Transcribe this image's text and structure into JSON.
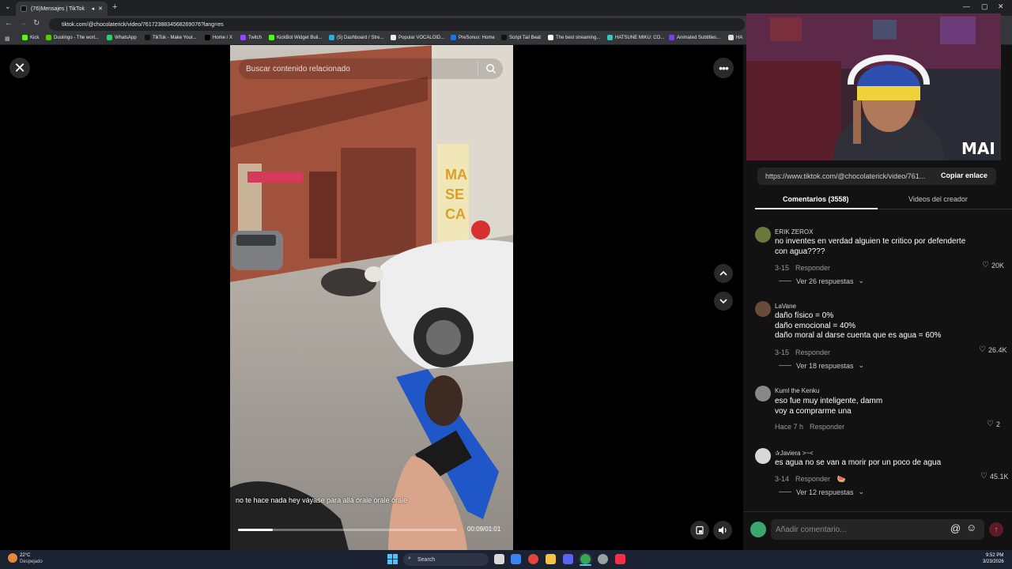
{
  "browser": {
    "tabs": [
      {
        "label": "(76)Mensajes | TikTok",
        "active": true
      },
      {
        "label": "",
        "active": false
      }
    ],
    "url": "tiktok.com/@chocolaterick/video/7617238834568269076?lang=es",
    "bookmarks": [
      {
        "label": "Kick",
        "color": "#53fc18"
      },
      {
        "label": "Duolingo - The worl...",
        "color": "#58cc02"
      },
      {
        "label": "WhatsApp",
        "color": "#25d366"
      },
      {
        "label": "TikTok - Make Your...",
        "color": "#111111"
      },
      {
        "label": "Home / X",
        "color": "#000000"
      },
      {
        "label": "Twitch",
        "color": "#9146ff"
      },
      {
        "label": "KickBot Widget Buil...",
        "color": "#53fc18"
      },
      {
        "label": "(5) Dashboard / Stre...",
        "color": "#3ad"
      },
      {
        "label": "Popular VOCALOID...",
        "color": "#eee"
      },
      {
        "label": "PreSonus: Home",
        "color": "#1a73e8"
      },
      {
        "label": "Script Tail Beat",
        "color": "#111"
      },
      {
        "label": "The best streaming...",
        "color": "#fff"
      },
      {
        "label": "HATSUNE MIKU: CO...",
        "color": "#39c5bb"
      },
      {
        "label": "Animated Subtitles...",
        "color": "#7b3fe4"
      },
      {
        "label": "HA",
        "color": "#ddd"
      }
    ]
  },
  "video": {
    "search_placeholder": "Buscar contenido relacionado",
    "caption": "no te hace nada hey váyase para allá órale órale órale",
    "time": "00:09/01:01",
    "progress": 0.16
  },
  "webcam": {
    "brand": "MAI"
  },
  "panel": {
    "link": "https://www.tiktok.com/@chocolaterick/video/761...",
    "copy_label": "Copiar enlace",
    "tab_comments": "Comentarios (3558)",
    "tab_creator": "Videos del creador",
    "comment_placeholder": "Añadir comentario...",
    "reply_label": "Responder",
    "comments": [
      {
        "user": "ERIK ZEROX",
        "lines": [
          "no inventes en verdad alguien te critico por defenderte",
          "con agua????"
        ],
        "date": "3-15",
        "likes": "20K",
        "more": "Ver 26 respuestas",
        "avatar_color": "#6b7a3a"
      },
      {
        "user": "LaVane",
        "lines": [
          "daño físico = 0%",
          "daño emocional = 40%",
          "daño moral al darse cuenta que es agua = 60%"
        ],
        "date": "3-15",
        "likes": "26.4K",
        "more": "Ver 18 respuestas",
        "avatar_color": "#6a4a3a"
      },
      {
        "user": "Kuml the Kenku",
        "lines": [
          "eso fue muy inteligente, damm",
          "voy a comprarme una"
        ],
        "date": "Hace 7 h",
        "likes": "2",
        "more": "",
        "avatar_color": "#888888"
      },
      {
        "user": "✰Javiera >~<",
        "lines": [
          "es agua no se van a morir por un poco de agua"
        ],
        "date": "3-14",
        "likes": "45.1K",
        "more": "Ver 12 respuestas",
        "avatar_color": "#d8d8d8"
      }
    ]
  },
  "taskbar": {
    "weather_temp": "22°C",
    "weather_desc": "Despejado",
    "search_label": "Search",
    "clock_time": "9:52 PM",
    "clock_date": "3/23/2026"
  }
}
